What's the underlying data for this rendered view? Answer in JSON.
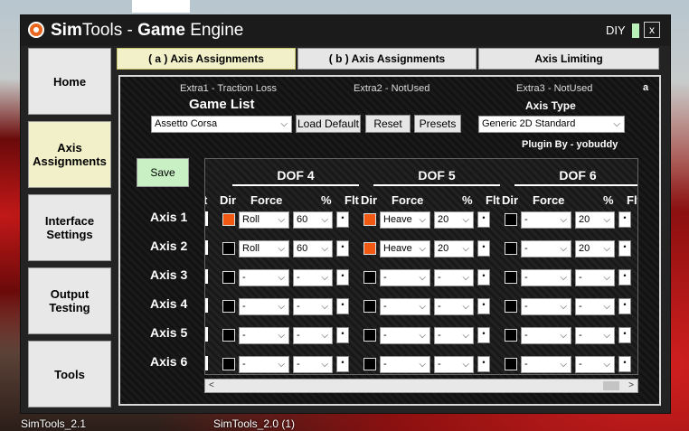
{
  "window": {
    "title_sim": "Sim",
    "title_tools": "Tools - ",
    "title_game": "Game",
    "title_engine": " Engine",
    "diy": "DIY",
    "close": "x"
  },
  "sidebar": [
    "Home",
    "Axis Assignments",
    "Interface Settings",
    "Output Testing",
    "Tools"
  ],
  "tabs": [
    "( a ) Axis Assignments",
    "( b ) Axis Assignments",
    "Axis Limiting"
  ],
  "extras": [
    "Extra1 - Traction Loss",
    "Extra2 - NotUsed",
    "Extra3 - NotUsed"
  ],
  "corner": "a",
  "game_list_label": "Game List",
  "game_selected": "Assetto Corsa",
  "load_default": "Load Default",
  "reset": "Reset",
  "presets": "Presets",
  "axis_type_label": "Axis Type",
  "axis_type_selected": "Generic 2D Standard",
  "plugin_by": "Plugin By - yobuddy",
  "save": "Save",
  "grid": {
    "dofs": [
      "DOF 4",
      "DOF 5",
      "DOF 6"
    ],
    "col_dir": "Dir",
    "col_force": "Force",
    "col_pct": "%",
    "col_flt": "Flt",
    "cut_char": "t",
    "flt_symbol": "•",
    "axes": [
      {
        "label": "Axis 1",
        "cells": [
          {
            "on": true,
            "force": "Roll",
            "pct": "60"
          },
          {
            "on": true,
            "force": "Heave",
            "pct": "20"
          },
          {
            "on": false,
            "force": "-",
            "pct": "20"
          }
        ]
      },
      {
        "label": "Axis 2",
        "cells": [
          {
            "on": false,
            "force": "Roll",
            "pct": "60"
          },
          {
            "on": true,
            "force": "Heave",
            "pct": "20"
          },
          {
            "on": false,
            "force": "-",
            "pct": "20"
          }
        ]
      },
      {
        "label": "Axis 3",
        "cells": [
          {
            "on": false,
            "force": "-",
            "pct": "-"
          },
          {
            "on": false,
            "force": "-",
            "pct": "-"
          },
          {
            "on": false,
            "force": "-",
            "pct": "-"
          }
        ]
      },
      {
        "label": "Axis 4",
        "cells": [
          {
            "on": false,
            "force": "-",
            "pct": "-"
          },
          {
            "on": false,
            "force": "-",
            "pct": "-"
          },
          {
            "on": false,
            "force": "-",
            "pct": "-"
          }
        ]
      },
      {
        "label": "Axis 5",
        "cells": [
          {
            "on": false,
            "force": "-",
            "pct": "-"
          },
          {
            "on": false,
            "force": "-",
            "pct": "-"
          },
          {
            "on": false,
            "force": "-",
            "pct": "-"
          }
        ]
      },
      {
        "label": "Axis 6",
        "cells": [
          {
            "on": false,
            "force": "-",
            "pct": "-"
          },
          {
            "on": false,
            "force": "-",
            "pct": "-"
          },
          {
            "on": false,
            "force": "-",
            "pct": "-"
          }
        ]
      }
    ]
  },
  "taskbar": [
    "SimTools_2.1",
    "SimTools_2.0 (1)"
  ],
  "colors": {
    "accent_orange": "#f25a14",
    "active_tab": "#f2f0c9",
    "save_green": "#c9f0c5"
  }
}
